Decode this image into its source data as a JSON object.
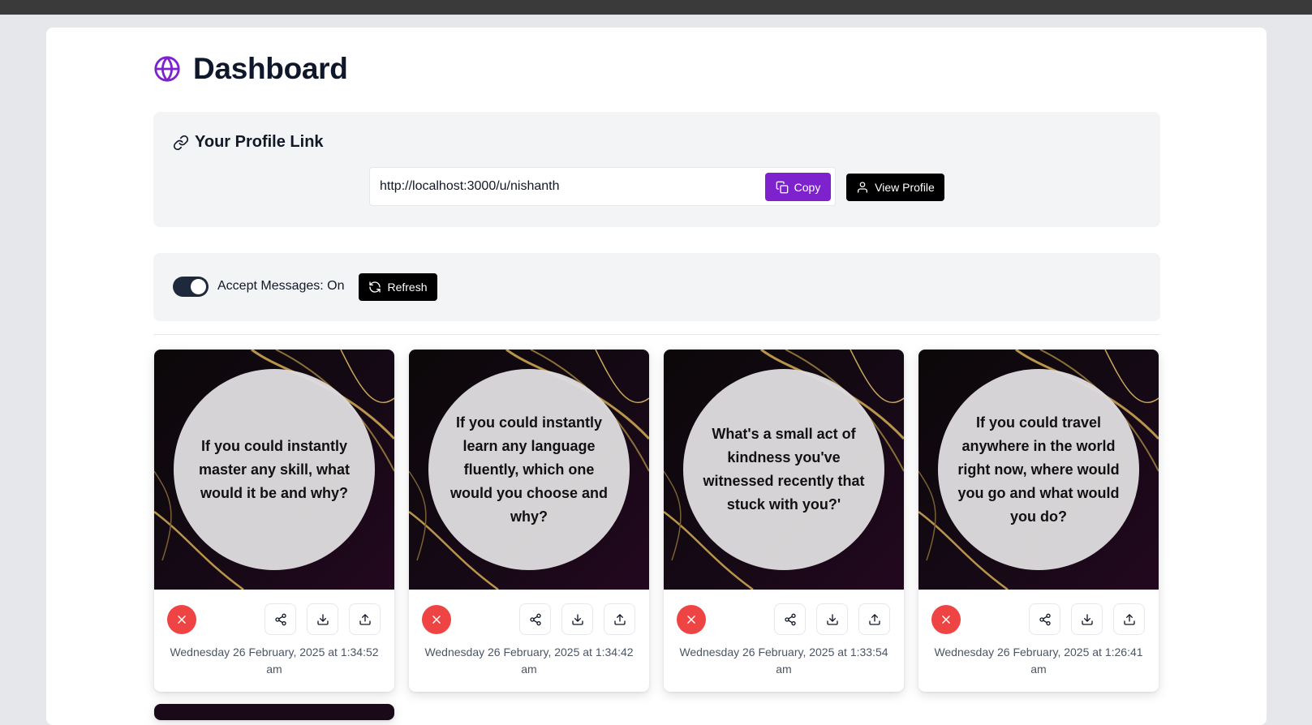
{
  "page": {
    "title": "Dashboard"
  },
  "profile_link": {
    "heading": "Your Profile Link",
    "url": "http://localhost:3000/u/nishanth",
    "copy_label": "Copy",
    "view_label": "View Profile"
  },
  "messages_settings": {
    "accept_label": "Accept Messages: On",
    "accept_enabled": true,
    "refresh_label": "Refresh"
  },
  "messages": [
    {
      "text": "If you could instantly master any skill, what would it be and why?",
      "date": "Wednesday 26 February, 2025 at 1:34:52 am"
    },
    {
      "text": "If you could instantly learn any language fluently, which one would you choose and why?",
      "date": "Wednesday 26 February, 2025 at 1:34:42 am"
    },
    {
      "text": "What's a small act of kindness you've witnessed recently that stuck with you?'",
      "date": "Wednesday 26 February, 2025 at 1:33:54 am"
    },
    {
      "text": "If you could travel anywhere in the world right now, where would you go and what would you do?",
      "date": "Wednesday 26 February, 2025 at 1:26:41 am"
    }
  ],
  "icons": {
    "title": "globe-icon",
    "link": "link-icon",
    "copy": "copy-icon",
    "view": "user-icon",
    "refresh": "refresh-icon",
    "delete": "x-icon",
    "share": "share-icon",
    "download": "download-icon",
    "upload": "upload-icon"
  },
  "colors": {
    "accent": "#7e22ce",
    "delete": "#ef4444",
    "dark_button": "#000000",
    "toggle_on": "#1e293b"
  }
}
